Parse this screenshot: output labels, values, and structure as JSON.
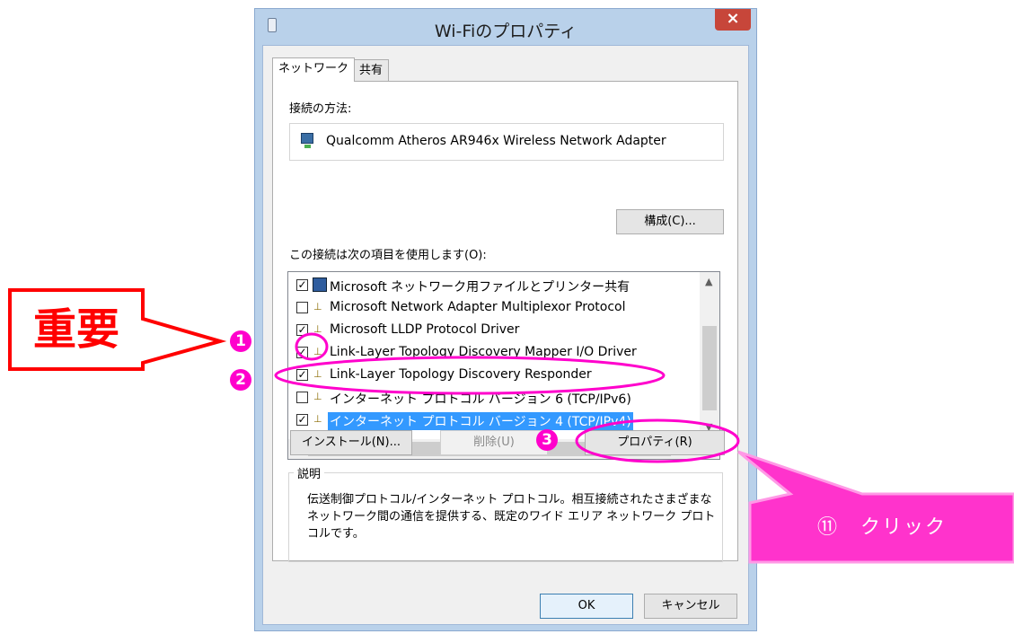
{
  "window": {
    "title": "Wi-Fiのプロパティ",
    "close_glyph": "×"
  },
  "tabs": [
    {
      "label": "ネットワーク",
      "active": true
    },
    {
      "label": "共有",
      "active": false
    }
  ],
  "connect_using": {
    "label": "接続の方法:",
    "adapter": "Qualcomm Atheros AR946x Wireless Network Adapter",
    "configure_button": "構成(C)..."
  },
  "items_section": {
    "label": "この接続は次の項目を使用します(O):",
    "items": [
      {
        "checked": true,
        "icon": "network-service-icon",
        "label": "Microsoft ネットワーク用ファイルとプリンター共有",
        "selected": false
      },
      {
        "checked": false,
        "icon": "protocol-icon",
        "label": "Microsoft Network Adapter Multiplexor Protocol",
        "selected": false
      },
      {
        "checked": true,
        "icon": "protocol-icon",
        "label": "Microsoft LLDP Protocol Driver",
        "selected": false
      },
      {
        "checked": true,
        "icon": "protocol-icon",
        "label": "Link-Layer Topology Discovery Mapper I/O Driver",
        "selected": false
      },
      {
        "checked": true,
        "icon": "protocol-icon",
        "label": "Link-Layer Topology Discovery Responder",
        "selected": false
      },
      {
        "checked": false,
        "icon": "protocol-icon",
        "label": "インターネット プロトコル バージョン 6 (TCP/IPv6)",
        "selected": false
      },
      {
        "checked": true,
        "icon": "protocol-icon",
        "label": "インターネット プロトコル バージョン 4 (TCP/IPv4)",
        "selected": true
      }
    ]
  },
  "buttons": {
    "install": "インストール(N)...",
    "uninstall": "削除(U)",
    "properties": "プロパティ(R)",
    "ok": "OK",
    "cancel": "キャンセル"
  },
  "description": {
    "title": "説明",
    "text": "伝送制御プロトコル/インターネット プロトコル。相互接続されたさまざまなネットワーク間の通信を提供する、既定のワイド エリア ネットワーク プロトコルです。"
  },
  "annotations": {
    "important_label": "重要",
    "badge_1": "1",
    "badge_2": "2",
    "badge_3": "3",
    "click_label": "⑪　クリック",
    "colors": {
      "red": "#ff0000",
      "pink": "#ff00cc",
      "magenta_box": "#ff33cc"
    }
  }
}
